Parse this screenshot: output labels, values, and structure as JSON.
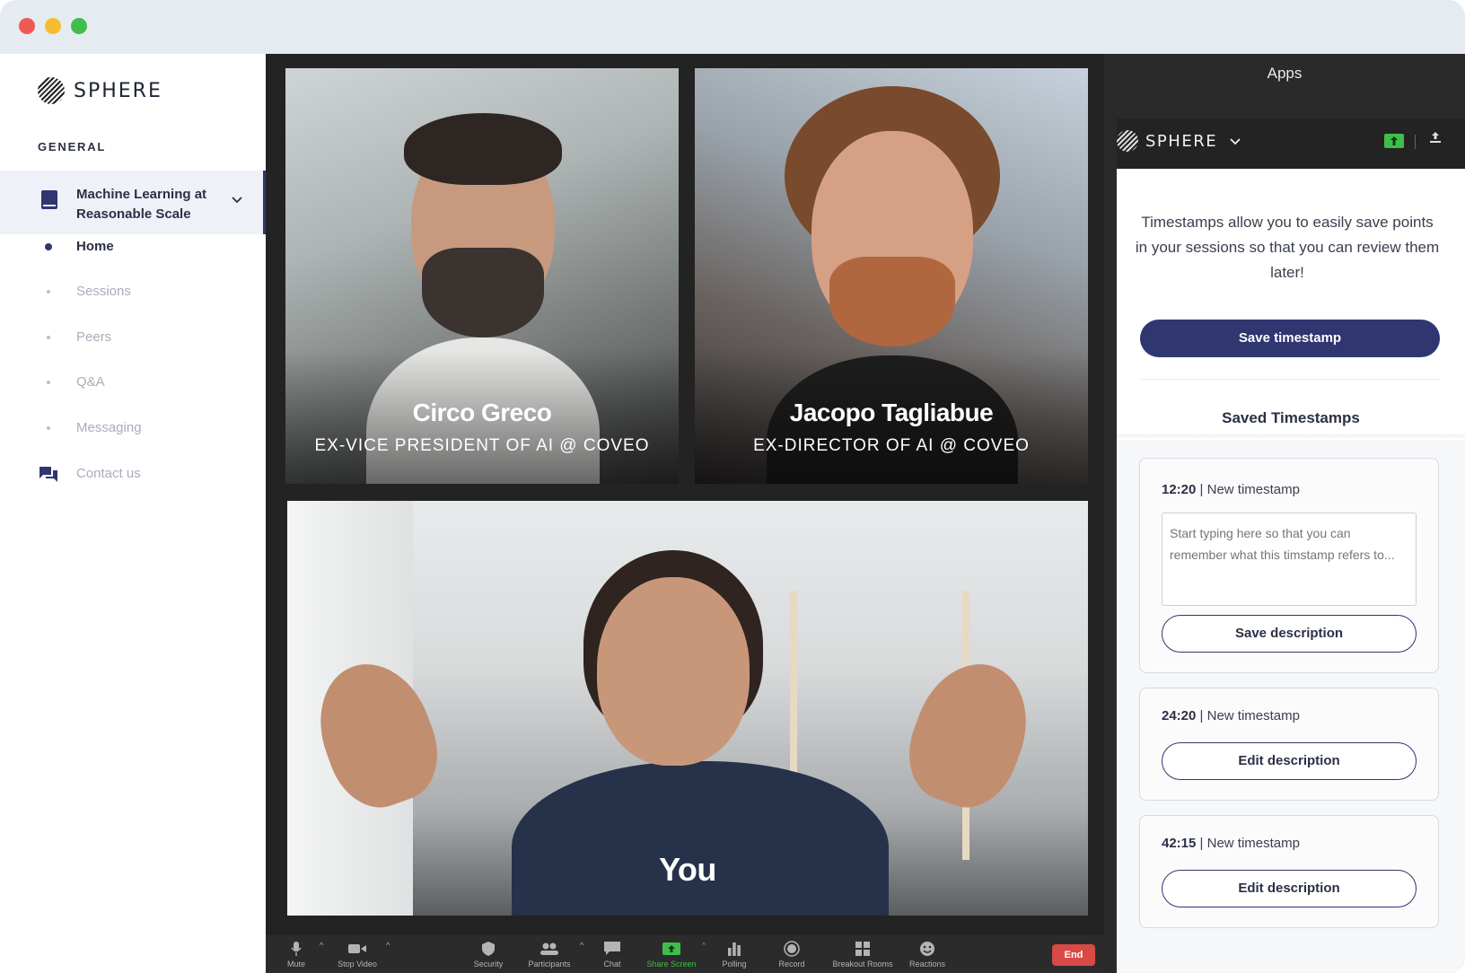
{
  "window": {
    "controls": [
      "close",
      "minimize",
      "maximize"
    ]
  },
  "sidebar": {
    "logo_text": "SPHERE",
    "section_title": "GENERAL",
    "course": {
      "title": "Machine Learning at Reasonable Scale"
    },
    "items": [
      {
        "label": "Home",
        "active": true
      },
      {
        "label": "Sessions",
        "active": false
      },
      {
        "label": "Peers",
        "active": false
      },
      {
        "label": "Q&A",
        "active": false
      },
      {
        "label": "Messaging",
        "active": false
      }
    ],
    "contact_label": "Contact us"
  },
  "video": {
    "participants": [
      {
        "name": "Circo Greco",
        "role": "EX-VICE PRESIDENT OF AI @ COVEO"
      },
      {
        "name": "Jacopo Tagliabue",
        "role": "EX-DIRECTOR OF AI @ COVEO"
      }
    ],
    "self_label": "You"
  },
  "toolbar": {
    "items": [
      "Mute",
      "Stop Video",
      "Security",
      "Participants",
      "Chat",
      "Share Screen",
      "Polling",
      "Record",
      "Breakout Rooms",
      "Reactions"
    ],
    "end_label": "End"
  },
  "apps": {
    "title": "Apps",
    "header_logo": "SPHERE",
    "intro": "Timestamps allow you to easily save points in your sessions so that you can review them later!",
    "save_button": "Save timestamp",
    "saved_title": "Saved Timestamps",
    "timestamps": [
      {
        "time": "12:20",
        "title": "New timestamp",
        "placeholder": "Start typing here so that you can remember what this timstamp refers to...",
        "button": "Save description"
      },
      {
        "time": "24:20",
        "title": "New timestamp",
        "button": "Edit description"
      },
      {
        "time": "42:15",
        "title": "New timestamp",
        "button": "Edit description"
      }
    ]
  },
  "colors": {
    "accent": "#2f3670",
    "end": "#d84a45",
    "share": "#3fbe4b"
  }
}
